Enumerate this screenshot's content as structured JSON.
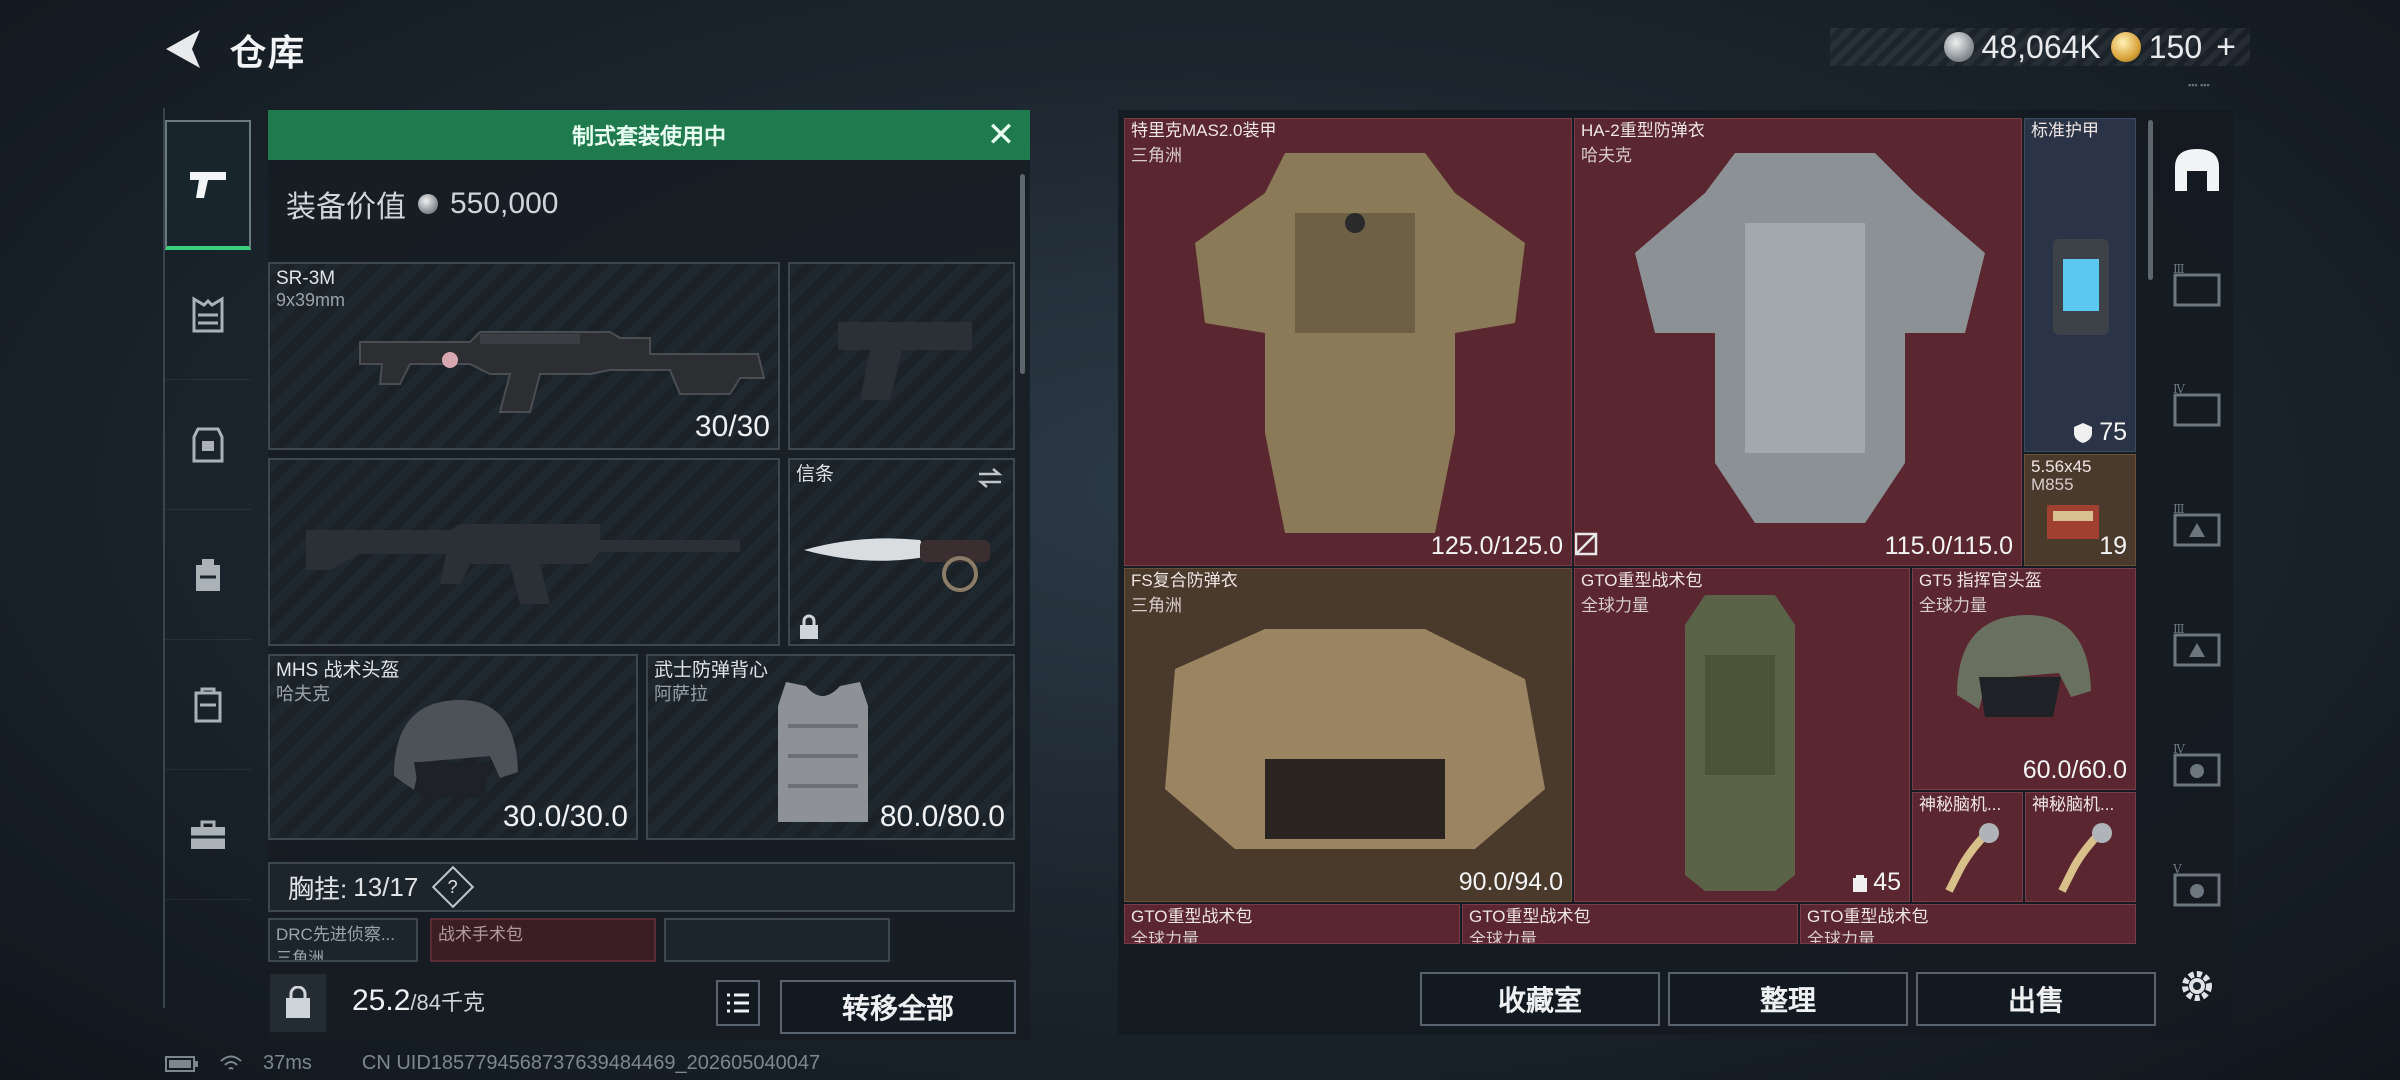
{
  "header": {
    "title": "仓库",
    "currencies": [
      {
        "icon": "silver-coin-icon",
        "value": "48,064K"
      },
      {
        "icon": "gold-coin-icon",
        "value": "150"
      }
    ],
    "plus_label": "+"
  },
  "left_nav": {
    "items": [
      {
        "name": "weapon-tab",
        "icon": "pistol-icon"
      },
      {
        "name": "vest-tab",
        "icon": "chest-rig-icon"
      },
      {
        "name": "armor-tab",
        "icon": "armor-icon"
      },
      {
        "name": "backpack-tab",
        "icon": "backpack-icon"
      },
      {
        "name": "bag-tab",
        "icon": "bag-icon"
      },
      {
        "name": "case-tab",
        "icon": "toolbox-icon"
      }
    ]
  },
  "loadout": {
    "banner": "制式套装使用中",
    "equip_value_label": "装备价值",
    "equip_value": "550,000",
    "slots": {
      "primary": {
        "name": "SR-3M",
        "sub": "9x39mm",
        "value": "30/30"
      },
      "melee": {
        "name": "信条"
      },
      "helmet": {
        "name": "MHS 战术头盔",
        "sub": "哈夫克",
        "value": "30.0/30.0"
      },
      "armor": {
        "name": "武士防弹背心",
        "sub": "阿萨拉",
        "value": "80.0/80.0"
      }
    },
    "chest_label": "胸挂:",
    "chest_count": "13/17",
    "chest_help": "?",
    "peek_items": [
      "DRC先进侦察...",
      "战术手术包"
    ],
    "peek_subs": [
      "三角洲"
    ],
    "weight": "25.2",
    "weight_max": "/84千克",
    "transfer_all": "转移全部"
  },
  "stash": {
    "items": [
      {
        "name": "特里克MAS2.0装甲",
        "sub": "三角洲",
        "value": "125.0/125.0"
      },
      {
        "name": "HA-2重型防弹衣",
        "sub": "哈夫克",
        "value": "115.0/115.0"
      },
      {
        "name": "标准护甲",
        "value": "75"
      },
      {
        "name": "5.56x45",
        "sub": "M855",
        "value": "19"
      },
      {
        "name": "FS复合防弹衣",
        "sub": "三角洲",
        "value": "90.0/94.0"
      },
      {
        "name": "GTO重型战术包",
        "sub": "全球力量",
        "value": "45"
      },
      {
        "name": "GT5 指挥官头盔",
        "sub": "全球力量",
        "value": "60.0/60.0"
      },
      {
        "name": "神秘脑机..."
      },
      {
        "name": "神秘脑机..."
      },
      {
        "name": "GTO重型战术包",
        "sub": "全球力量"
      },
      {
        "name": "GTO重型战术包",
        "sub": "全球力量"
      },
      {
        "name": "GTO重型战术包",
        "sub": "全球力量"
      }
    ],
    "buttons": {
      "collection": "收藏室",
      "sort": "整理",
      "sell": "出售"
    }
  },
  "right_nav": {
    "roman": [
      "Ⅲ",
      "Ⅳ",
      "Ⅲ",
      "Ⅲ",
      "Ⅳ",
      "Ⅴ"
    ]
  },
  "status": {
    "ping": "37ms",
    "uid": "CN UID1857794568737639484469_202605040047"
  },
  "colors": {
    "accent_green": "#1f7a4e",
    "item_red": "#5a2630",
    "item_brown": "#4a3a2c",
    "item_navy": "#2a3446"
  }
}
